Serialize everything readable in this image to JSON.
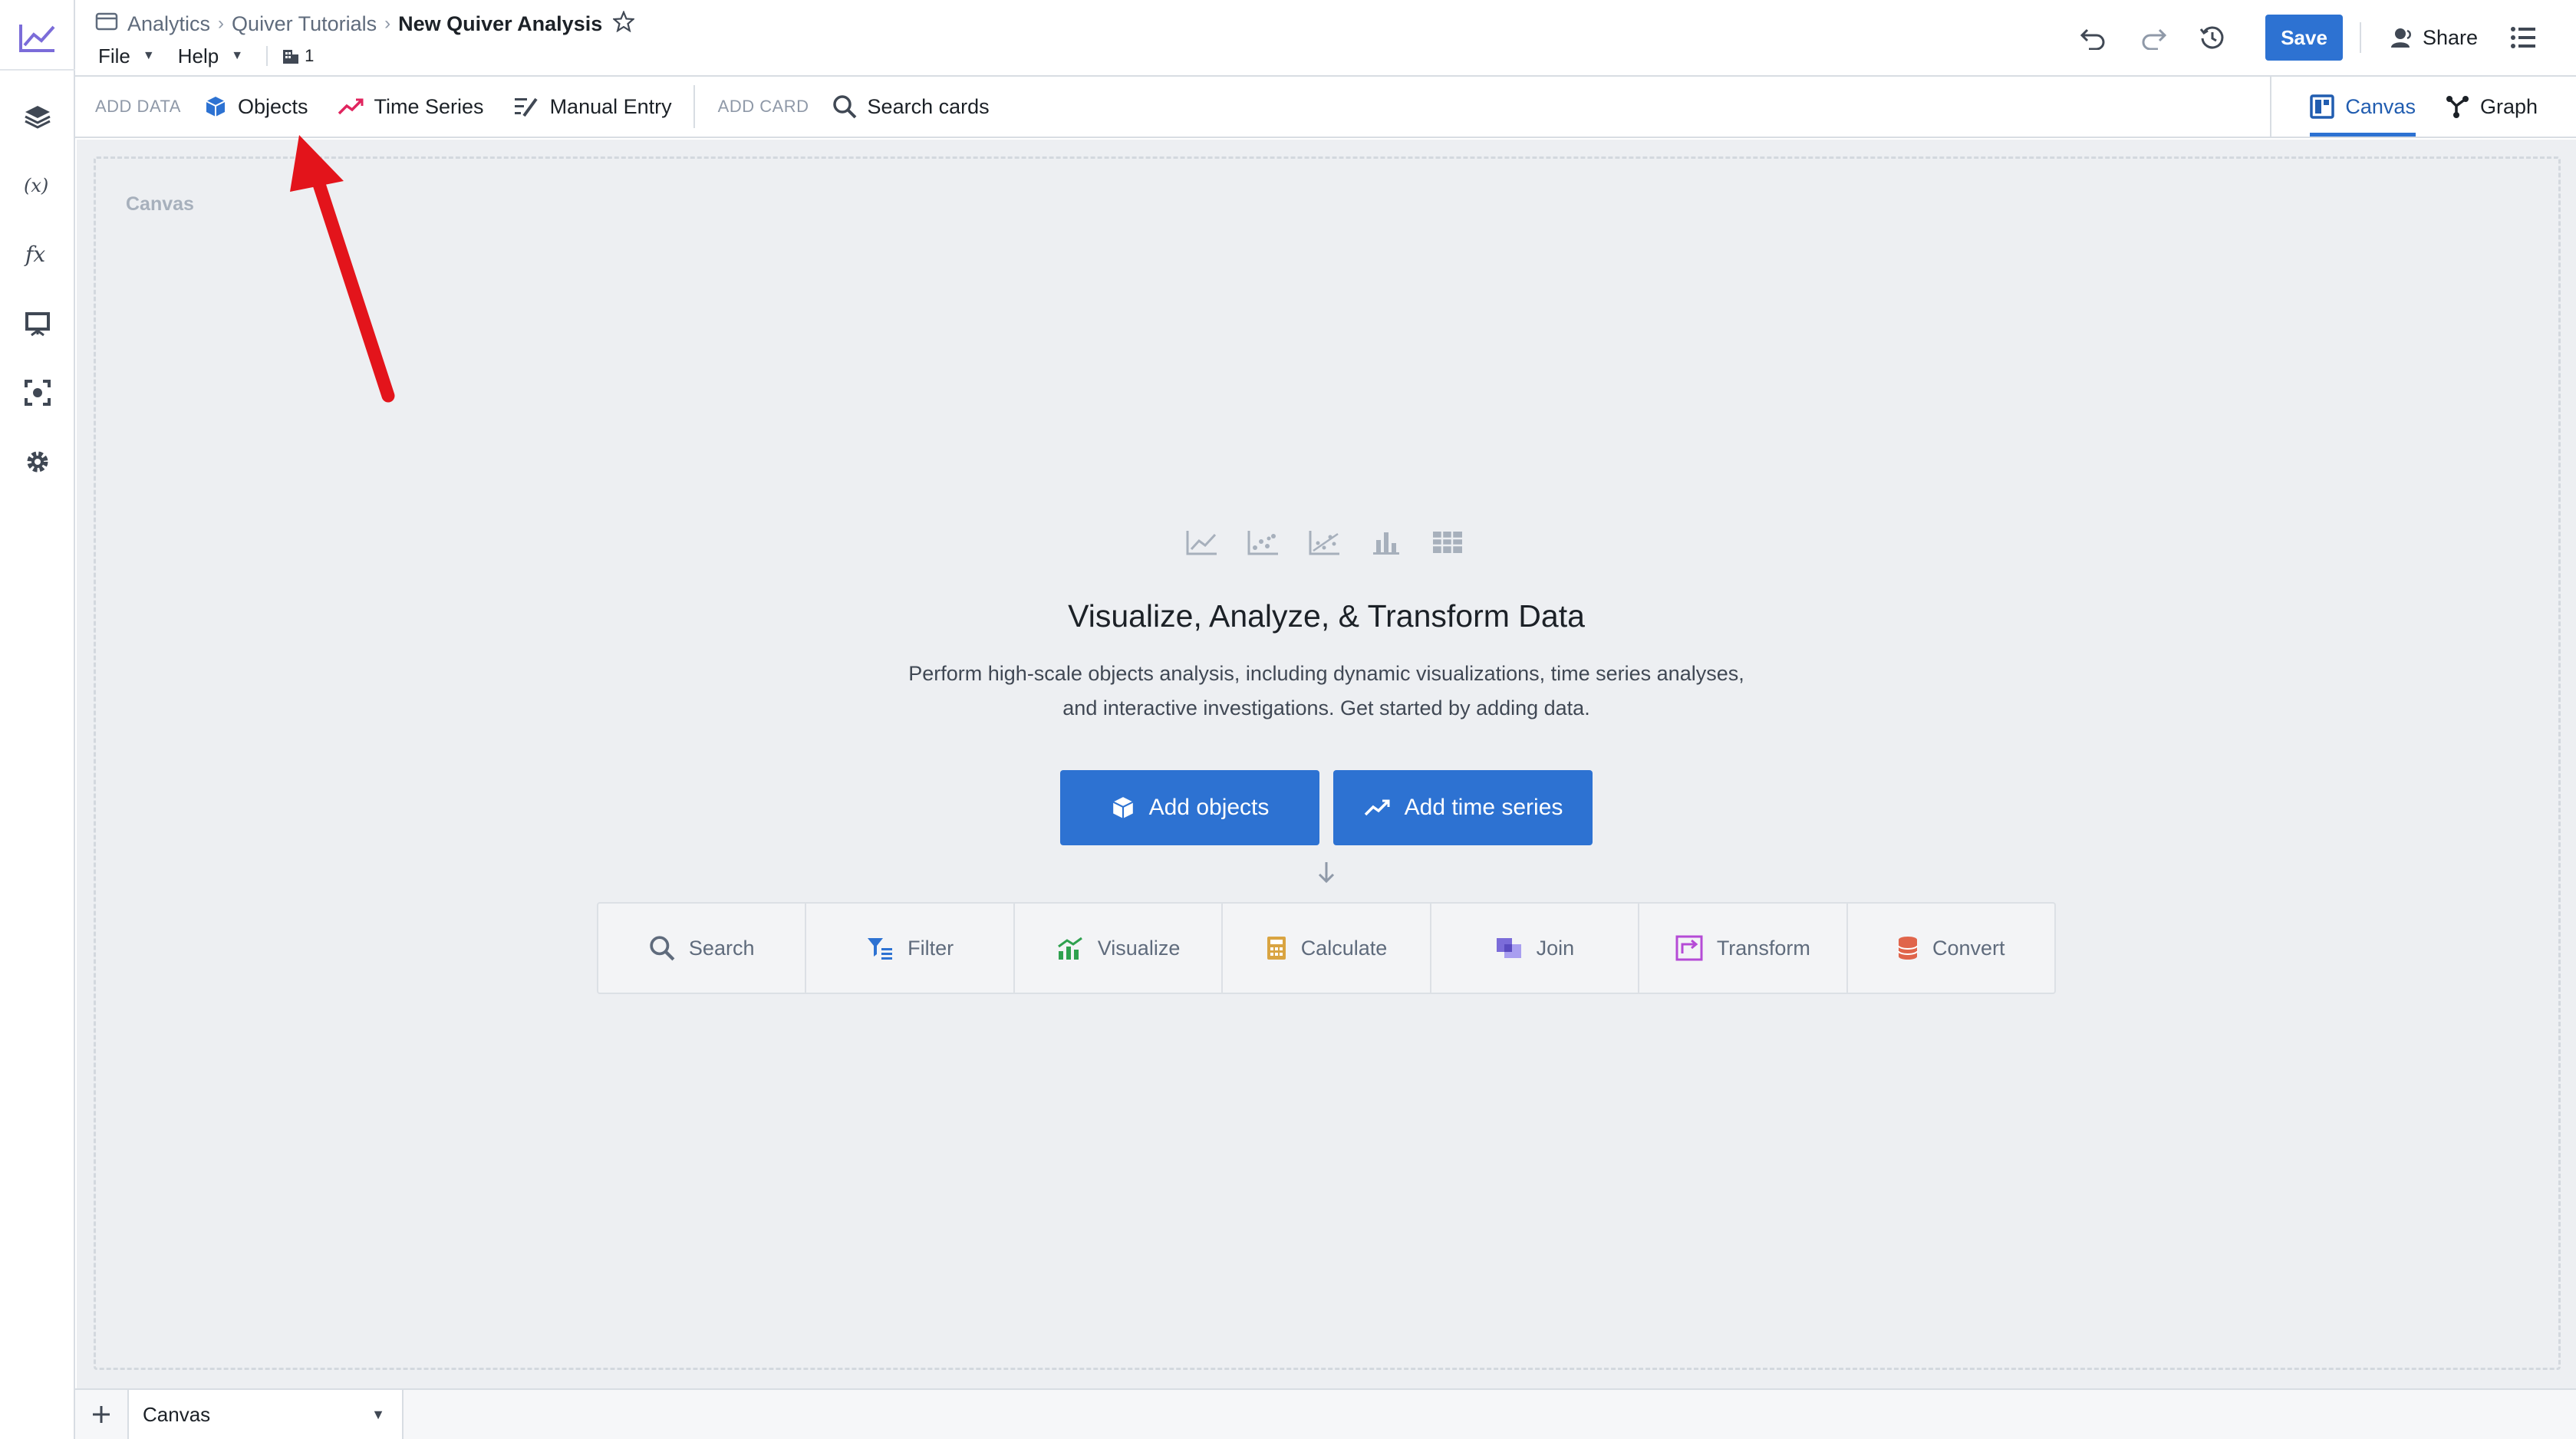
{
  "breadcrumb": {
    "items": [
      "Analytics",
      "Quiver Tutorials"
    ],
    "current": "New Quiver Analysis"
  },
  "menus": {
    "file": "File",
    "help": "Help",
    "building_count": "1"
  },
  "header": {
    "save_label": "Save",
    "share_label": "Share"
  },
  "toolbar": {
    "add_data_label": "ADD DATA",
    "objects_label": "Objects",
    "time_series_label": "Time Series",
    "manual_entry_label": "Manual Entry",
    "add_card_label": "ADD CARD",
    "search_cards_label": "Search cards",
    "canvas_tab_label": "Canvas",
    "graph_tab_label": "Graph"
  },
  "canvas": {
    "label": "Canvas",
    "title": "Visualize, Analyze, & Transform Data",
    "description_line1": "Perform high-scale objects analysis, including dynamic visualizations, time series analyses,",
    "description_line2": "and interactive investigations. Get started by adding data.",
    "add_objects_label": "Add objects",
    "add_time_series_label": "Add time series",
    "steps": [
      "Search",
      "Filter",
      "Visualize",
      "Calculate",
      "Join",
      "Transform",
      "Convert"
    ]
  },
  "bottom_bar": {
    "tab_label": "Canvas"
  },
  "colors": {
    "primary": "#2d72d2",
    "annotation_arrow": "#e3141b",
    "time_series_icon": "#e0245e",
    "visualize_icon": "#2fa14f",
    "calculate_icon": "#d9a441",
    "join_icon": "#7b6cd9",
    "transform_icon": "#b54bd6",
    "convert_icon": "#e0654b"
  }
}
